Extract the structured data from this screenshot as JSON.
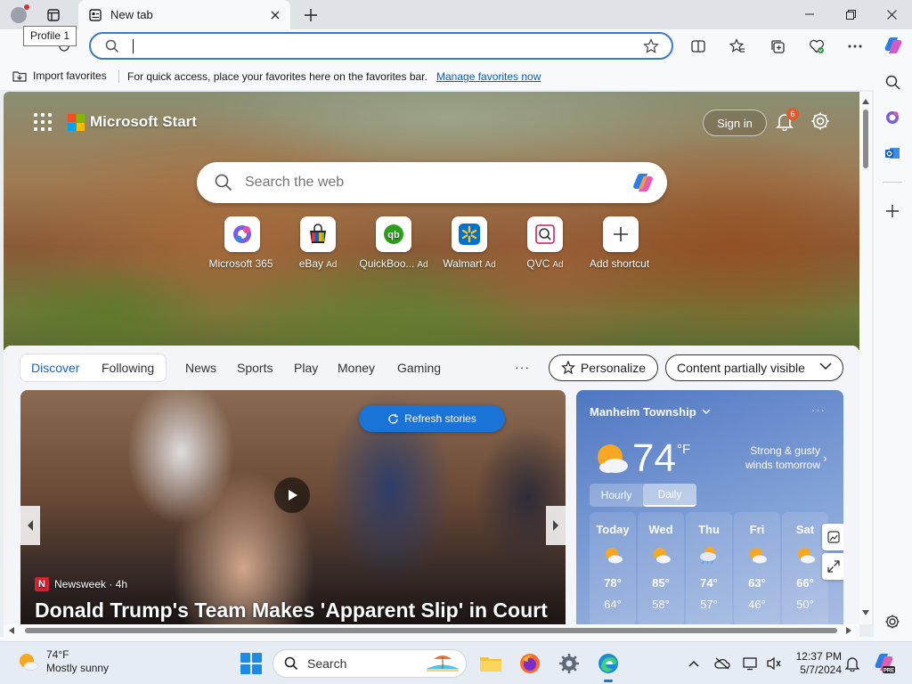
{
  "browser": {
    "tooltip": "Profile 1",
    "tab_title": "New tab",
    "address_value": "",
    "favorites_bar": {
      "import_label": "Import favorites",
      "message": "For quick access, place your favorites here on the favorites bar.",
      "manage_link": "Manage favorites now"
    }
  },
  "newtab": {
    "brand": "Microsoft Start",
    "signin_label": "Sign in",
    "notification_count": "6",
    "search_placeholder": "Search the web",
    "shortcuts": [
      {
        "label": "Microsoft 365",
        "ad": "",
        "icon": "microsoft365-icon"
      },
      {
        "label": "eBay",
        "ad": "Ad",
        "icon": "ebay-icon"
      },
      {
        "label": "QuickBoo...",
        "ad": "Ad",
        "icon": "quickbooks-icon"
      },
      {
        "label": "Walmart",
        "ad": "Ad",
        "icon": "walmart-icon"
      },
      {
        "label": "QVC",
        "ad": "Ad",
        "icon": "qvc-icon"
      },
      {
        "label": "Add shortcut",
        "ad": "",
        "icon": "plus-icon"
      }
    ],
    "feed_nav": {
      "tabs": [
        "Discover",
        "Following"
      ],
      "categories": [
        "News",
        "Sports",
        "Play",
        "Money",
        "Gaming"
      ],
      "more": "···",
      "personalize": "Personalize",
      "visibility": "Content partially visible"
    },
    "news": {
      "refresh_label": "Refresh stories",
      "source": "Newsweek · 4h",
      "source_logo": "N",
      "headline": "Donald Trump's Team Makes 'Apparent Slip' in Court"
    },
    "weather": {
      "location": "Manheim Township",
      "more": "···",
      "temp": "74",
      "unit": "°F",
      "forecast_line1": "Strong & gusty",
      "forecast_line2": "winds tomorrow",
      "toggle": [
        "Hourly",
        "Daily"
      ],
      "days": [
        {
          "name": "Today",
          "hi": "78°",
          "lo": "64°",
          "icon": "partly-sunny-icon"
        },
        {
          "name": "Wed",
          "hi": "85°",
          "lo": "58°",
          "icon": "partly-sunny-icon"
        },
        {
          "name": "Thu",
          "hi": "74°",
          "lo": "57°",
          "icon": "rain-icon"
        },
        {
          "name": "Fri",
          "hi": "63°",
          "lo": "46°",
          "icon": "partly-sunny-icon"
        },
        {
          "name": "Sat",
          "hi": "66°",
          "lo": "50°",
          "icon": "partly-sunny-icon"
        }
      ]
    }
  },
  "taskbar": {
    "weather_temp": "74°F",
    "weather_desc": "Mostly sunny",
    "search_label": "Search",
    "time": "12:37 PM",
    "date": "5/7/2024"
  },
  "colors": {
    "accent": "#1a73d6",
    "address_border": "#3b79c9",
    "link": "#0f5bbd"
  }
}
